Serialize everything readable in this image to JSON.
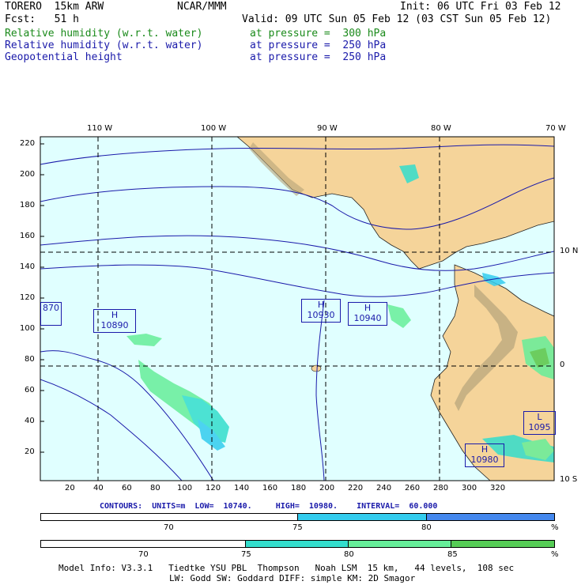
{
  "header": {
    "model": "TORERO  15km ARW",
    "center": "NCAR/MMM",
    "init": "Init: 06 UTC Fri 03 Feb 12",
    "fcst": "Fcst:   51 h",
    "valid": "Valid: 09 UTC Sun 05 Feb 12 (03 CST Sun 05 Feb 12)",
    "fields": [
      {
        "name": "Relative humidity (w.r.t. water)",
        "level": "at pressure =  300 hPa",
        "color": "#1a8a1a"
      },
      {
        "name": "Relative humidity (w.r.t. water)",
        "level": "at pressure =  250 hPa",
        "color": "#1a1aaa"
      },
      {
        "name": "Geopotential height",
        "level": "at pressure =  250 hPa",
        "color": "#1a1aaa"
      }
    ]
  },
  "map": {
    "top_lon_labels": [
      "110 W",
      "100 W",
      "90 W",
      "80 W",
      "70 W"
    ],
    "right_lat_labels": [
      "10 N",
      "0",
      "10 S"
    ],
    "left_grid_labels": [
      "220",
      "200",
      "180",
      "160",
      "140",
      "120",
      "100",
      "80",
      "60",
      "40",
      "20"
    ],
    "bottom_grid_labels": [
      "20",
      "40",
      "60",
      "80",
      "100",
      "120",
      "140",
      "160",
      "180",
      "200",
      "220",
      "240",
      "260",
      "280",
      "300",
      "320"
    ],
    "highs_lows": [
      {
        "label": "",
        "value": "870"
      },
      {
        "label": "H",
        "value": "10890"
      },
      {
        "label": "H",
        "value": "10930"
      },
      {
        "label": "H",
        "value": "10940"
      },
      {
        "label": "H",
        "value": "10980"
      },
      {
        "label": "L",
        "value": "1095"
      }
    ]
  },
  "contours": {
    "text": "CONTOURS:  UNITS=m  LOW=  10740.     HIGH=  10980.    INTERVAL=  60.000"
  },
  "legend_250": {
    "labels": [
      "70",
      "75",
      "80",
      "%"
    ],
    "colors": [
      "#ffffff",
      "#33ccee",
      "#4488ee"
    ]
  },
  "legend_300": {
    "labels": [
      "70",
      "75",
      "80",
      "85",
      "%"
    ],
    "colors": [
      "#ffffff",
      "#33ddcc",
      "#66ee99",
      "#55cc55"
    ]
  },
  "footer": {
    "line1": "Model Info: V3.3.1   Tiedtke YSU PBL  Thompson   Noah LSM  15 km,   44 levels,  108 sec",
    "line2": "LW: Godd SW: Goddard DIFF: simple KM: 2D Smagor"
  }
}
